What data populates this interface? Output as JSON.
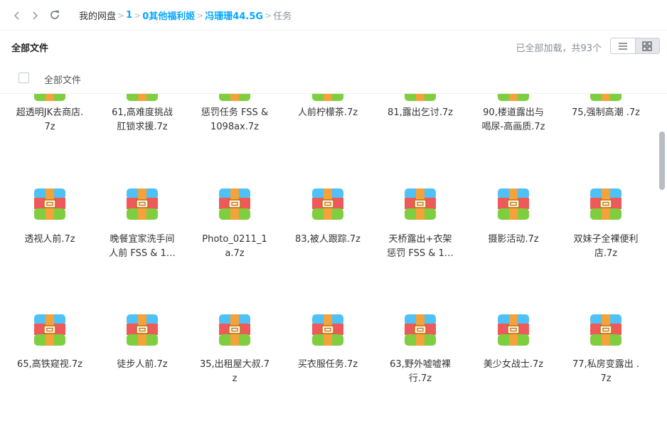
{
  "breadcrumb": {
    "root": "我的网盘",
    "items": [
      "1",
      "0其他福利姬",
      "冯珊珊44.5G"
    ],
    "current": "任务"
  },
  "toolbar": {
    "title": "全部文件",
    "status": "已全部加载，共93个"
  },
  "select_bar": {
    "label": "全部文件"
  },
  "icons": {
    "back": "chevron-left-icon",
    "forward": "chevron-right-icon",
    "refresh": "refresh-icon",
    "list_view": "list-view-icon",
    "grid_view": "grid-view-icon",
    "archive": "archive-7z-icon"
  },
  "colors": {
    "accent": "#06a7ff",
    "archive_top": "#4ec1f6",
    "archive_mid": "#ee5a5a",
    "archive_bottom": "#7fce3f",
    "archive_strap": "#f4a23a"
  },
  "files": [
    [
      "超透明JK去商店.\n7z",
      "61,高难度挑战\n肛锁求援.7z",
      "惩罚任务 FSS &\n1098ax.7z",
      "人前柠檬茶.7z",
      "81,露出乞讨.7z",
      "90,楼道露出与\n喝尿-高画质.7z",
      "75,强制高潮 .7z"
    ],
    [
      "透视人前.7z",
      "晚餐宜家洗手间\n人前 FSS & 1…",
      "Photo_0211_1\na.7z",
      "83,被人跟踪.7z",
      "天桥露出+衣架\n惩罚 FSS & 1…",
      "摄影活动.7z",
      "双妹子全裸便利\n店.7z"
    ],
    [
      "65,高铁窥视.7z",
      "徒步人前.7z",
      "35,出租屋大叔.7\nz",
      "买衣服任务.7z",
      "63,野外嘘嘘裸\n行.7z",
      "美少女战士.7z",
      "77,私房变露出 .\n7z"
    ]
  ]
}
